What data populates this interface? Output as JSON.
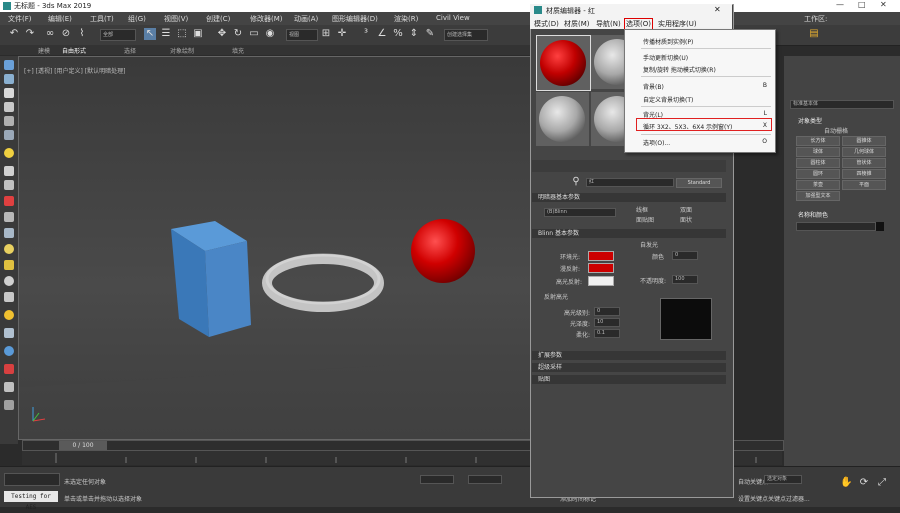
{
  "app": {
    "title": "无标题 - 3ds Max 2019",
    "window_controls": [
      "—",
      "□",
      "✕"
    ]
  },
  "menubar": {
    "items": [
      "文件(F)",
      "编辑(E)",
      "工具(T)",
      "组(G)",
      "视图(V)",
      "创建(C)",
      "修改器(M)",
      "动画(A)",
      "图形编辑器(D)",
      "渲染(R)",
      "Civil View"
    ],
    "workspace_label": "工作区:"
  },
  "toolbar": {
    "filter_value": "全部",
    "view_value": "视图",
    "selection_set": "创建选择集"
  },
  "ribbon": {
    "tabs": [
      "建模",
      "自由形式",
      "选择",
      "对象绘制",
      "填充"
    ]
  },
  "viewport": {
    "label": "[+] [透视] [用户定义] [默认明暗处理]"
  },
  "timeline": {
    "frame": "0 / 100"
  },
  "status": {
    "no_selection": "未选定任何对象",
    "hint": "单击或单击并拖动以选择对象",
    "testing_label": "Testing for AES",
    "add_time_tag": "添加时间标记",
    "auto_key": "自动关键点",
    "selected": "选定对象",
    "set_key": "设置关键点",
    "key_filter": "关键点过滤器..."
  },
  "command_panel": {
    "category": "标准基本体",
    "rollout_object_type": "对象类型",
    "autogrid": "自动栅格",
    "buttons": [
      "长方体",
      "圆锥体",
      "球体",
      "几何球体",
      "圆柱体",
      "管状体",
      "圆环",
      "四棱锥",
      "茶壶",
      "平面",
      "加强型文本"
    ],
    "rollout_name_color": "名称和颜色"
  },
  "material_editor": {
    "title": "材质编辑器 - 红",
    "menu": [
      "模式(D)",
      "材质(M)",
      "导航(N)",
      "选项(O)",
      "实用程序(U)"
    ],
    "material_name": "红",
    "material_type": "Standard",
    "rollout_shader": "明暗器基本参数",
    "shader_value": "(B)Blinn",
    "shader_options": [
      "线框",
      "双面",
      "面贴图",
      "面状"
    ],
    "rollout_blinn": "Blinn 基本参数",
    "self_illum": "自发光",
    "color_label": "颜色",
    "ambient": "环境光:",
    "diffuse": "漫反射:",
    "specular": "高光反射:",
    "opacity": "不透明度:",
    "opacity_value": "100",
    "self_illum_value": "0",
    "spec_highlights": "反射高光",
    "spec_level": "高光级别:",
    "glossiness": "光泽度:",
    "soften": "柔化:",
    "spec_level_value": "0",
    "glossiness_value": "10",
    "soften_value": "0.1",
    "rollout_extended": "扩展参数",
    "rollout_supersampling": "超级采样",
    "rollout_maps": "贴图",
    "ambient_color": "#cc0000",
    "diffuse_color": "#cc0000",
    "specular_color": "#f0f0f0"
  },
  "options_menu": {
    "items": [
      {
        "label": "传播材质到实例(P)",
        "key": ""
      },
      {
        "label": "手动更新切换(U)",
        "key": ""
      },
      {
        "label": "复制/旋转 拖动模式切换(R)",
        "key": ""
      },
      {
        "label": "背景(B)",
        "key": "B"
      },
      {
        "label": "自定义背景切换(T)",
        "key": ""
      },
      {
        "label": "背光(L)",
        "key": "L"
      },
      {
        "label": "循环 3X2、5X3、6X4 示例窗(Y)",
        "key": "X"
      },
      {
        "label": "选项(O)...",
        "key": "O"
      }
    ]
  },
  "colors": {
    "box": "#3f7fc0",
    "torus": "#b8b8b8",
    "sphere": "#d00000",
    "highlight": "#e02020"
  }
}
